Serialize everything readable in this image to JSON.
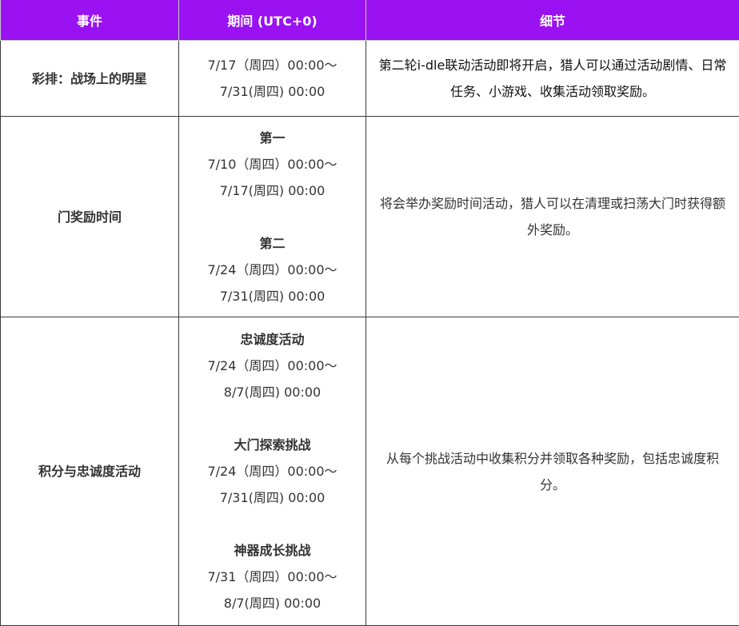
{
  "header": {
    "event": "事件",
    "period": "期间 (UTC+0)",
    "detail": "细节"
  },
  "rows": [
    {
      "event": "彩排：战场上的明星",
      "period_lines": [
        "7/17（周四）00:00～",
        "7/31(周四) 00:00"
      ],
      "detail": "第二轮i-dle联动活动即将开启，猎人可以通过活动剧情、日常任务、小游戏、收集活动领取奖励。"
    },
    {
      "event": "门奖励时间",
      "blocks": [
        {
          "title": "第一",
          "lines": [
            "7/10（周四）00:00～",
            "7/17(周四) 00:00"
          ]
        },
        {
          "title": "第二",
          "lines": [
            "7/24（周四）00:00～",
            "7/31(周四) 00:00"
          ]
        }
      ],
      "detail": "将会举办奖励时间活动，猎人可以在清理或扫荡大门时获得额外奖励。"
    },
    {
      "event": "积分与忠诚度活动",
      "blocks": [
        {
          "title": "忠诚度活动",
          "lines": [
            "7/24（周四）00:00～",
            "8/7(周四) 00:00"
          ]
        },
        {
          "title": "大门探索挑战",
          "lines": [
            "7/24（周四）00:00～",
            "7/31(周四) 00:00"
          ]
        },
        {
          "title": "神器成长挑战",
          "lines": [
            "7/31（周四）00:00～",
            "8/7(周四) 00:00"
          ]
        }
      ],
      "detail": "从每个挑战活动中收集积分并领取各种奖励，包括忠诚度积分。"
    }
  ]
}
